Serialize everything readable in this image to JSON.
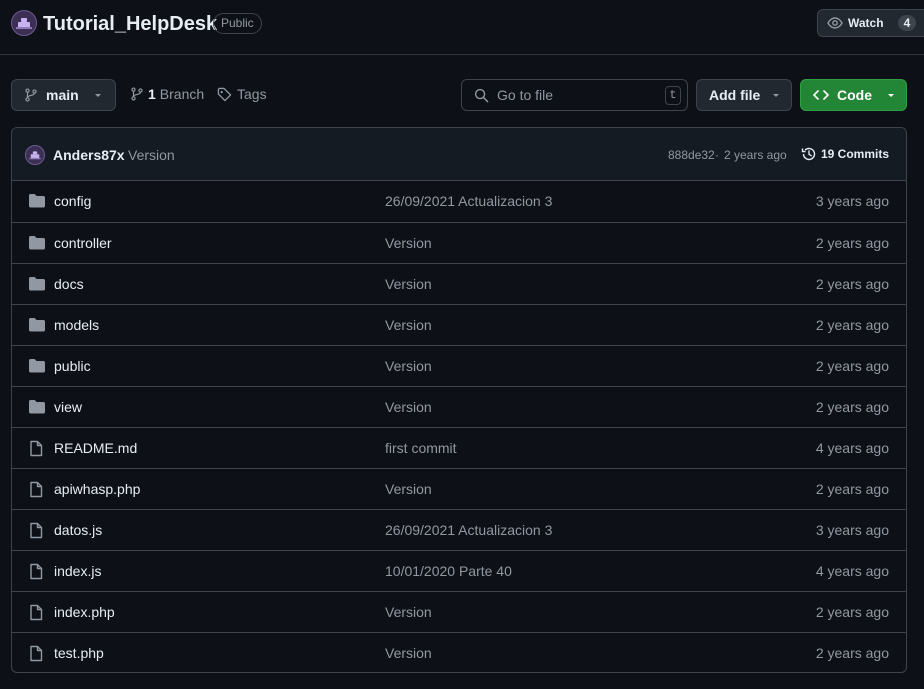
{
  "repo": {
    "name": "Tutorial_HelpDesk",
    "visibility": "Public",
    "watch_label": "Watch",
    "watch_count": "4"
  },
  "toolbar": {
    "branch": "main",
    "branch_count": "1",
    "branch_word": "Branch",
    "tags_label": "Tags",
    "search_placeholder": "Go to file",
    "search_shortcut": "t",
    "add_file_label": "Add file",
    "code_label": "Code"
  },
  "latest_commit": {
    "author": "Anders87x",
    "message": "Version",
    "hash": "888de32",
    "separator": "·",
    "age": "2 years ago",
    "commits_label": "19 Commits"
  },
  "files": [
    {
      "name": "config",
      "type": "folder",
      "message": "26/09/2021 Actualizacion 3",
      "age": "3 years ago"
    },
    {
      "name": "controller",
      "type": "folder",
      "message": "Version",
      "age": "2 years ago"
    },
    {
      "name": "docs",
      "type": "folder",
      "message": "Version",
      "age": "2 years ago"
    },
    {
      "name": "models",
      "type": "folder",
      "message": "Version",
      "age": "2 years ago"
    },
    {
      "name": "public",
      "type": "folder",
      "message": "Version",
      "age": "2 years ago"
    },
    {
      "name": "view",
      "type": "folder",
      "message": "Version",
      "age": "2 years ago"
    },
    {
      "name": "README.md",
      "type": "file",
      "message": "first commit",
      "age": "4 years ago"
    },
    {
      "name": "apiwhasp.php",
      "type": "file",
      "message": "Version",
      "age": "2 years ago"
    },
    {
      "name": "datos.js",
      "type": "file",
      "message": "26/09/2021 Actualizacion 3",
      "age": "3 years ago"
    },
    {
      "name": "index.js",
      "type": "file",
      "message": "10/01/2020 Parte 40",
      "age": "4 years ago"
    },
    {
      "name": "index.php",
      "type": "file",
      "message": "Version",
      "age": "2 years ago"
    },
    {
      "name": "test.php",
      "type": "file",
      "message": "Version",
      "age": "2 years ago"
    }
  ],
  "colors": {
    "background": "#0d1117",
    "border": "#3d444d",
    "muted_text": "#9198a1",
    "primary_text": "#e6edf3",
    "code_button": "#238636",
    "folder_icon": "#9198a1"
  }
}
